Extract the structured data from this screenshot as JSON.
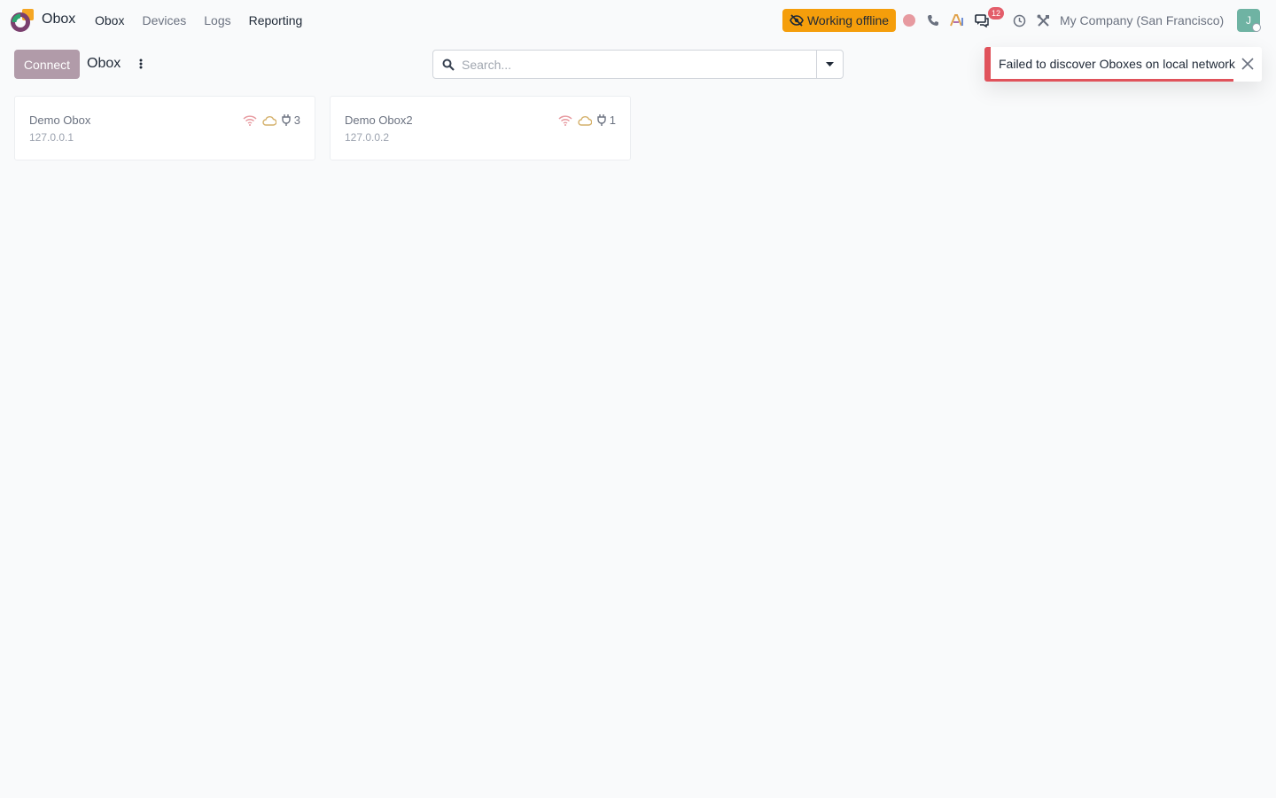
{
  "app": {
    "name": "Obox"
  },
  "nav": {
    "items": [
      "Obox",
      "Devices",
      "Logs",
      "Reporting"
    ]
  },
  "systray": {
    "offline_label": "Working offline",
    "chat_count": "12",
    "company": "My Company (San Francisco)",
    "avatar_initial": "J"
  },
  "control": {
    "connect_label": "Connect",
    "title": "Obox",
    "search_placeholder": "Search..."
  },
  "notification": {
    "message": "Failed to discover Oboxes on local network"
  },
  "cards": [
    {
      "name": "Demo Obox",
      "ip": "127.0.0.1",
      "plug_count": "3"
    },
    {
      "name": "Demo Obox2",
      "ip": "127.0.0.2",
      "plug_count": "1"
    }
  ],
  "colors": {
    "offline": "#f59e0b",
    "connect_button": "#b19ba9",
    "notification_accent": "#e0525b",
    "wifi_icon": "#e79aa0",
    "cloud_icon": "#d4b06a"
  },
  "icons": [
    "app-logo",
    "crossed-eye-icon",
    "record-icon",
    "phone-icon",
    "ai-icon",
    "chat-icon",
    "clock-icon",
    "tools-icon",
    "kebab-icon",
    "search-icon",
    "caret-down-icon",
    "close-icon",
    "wifi-icon",
    "cloud-icon",
    "plug-icon"
  ]
}
